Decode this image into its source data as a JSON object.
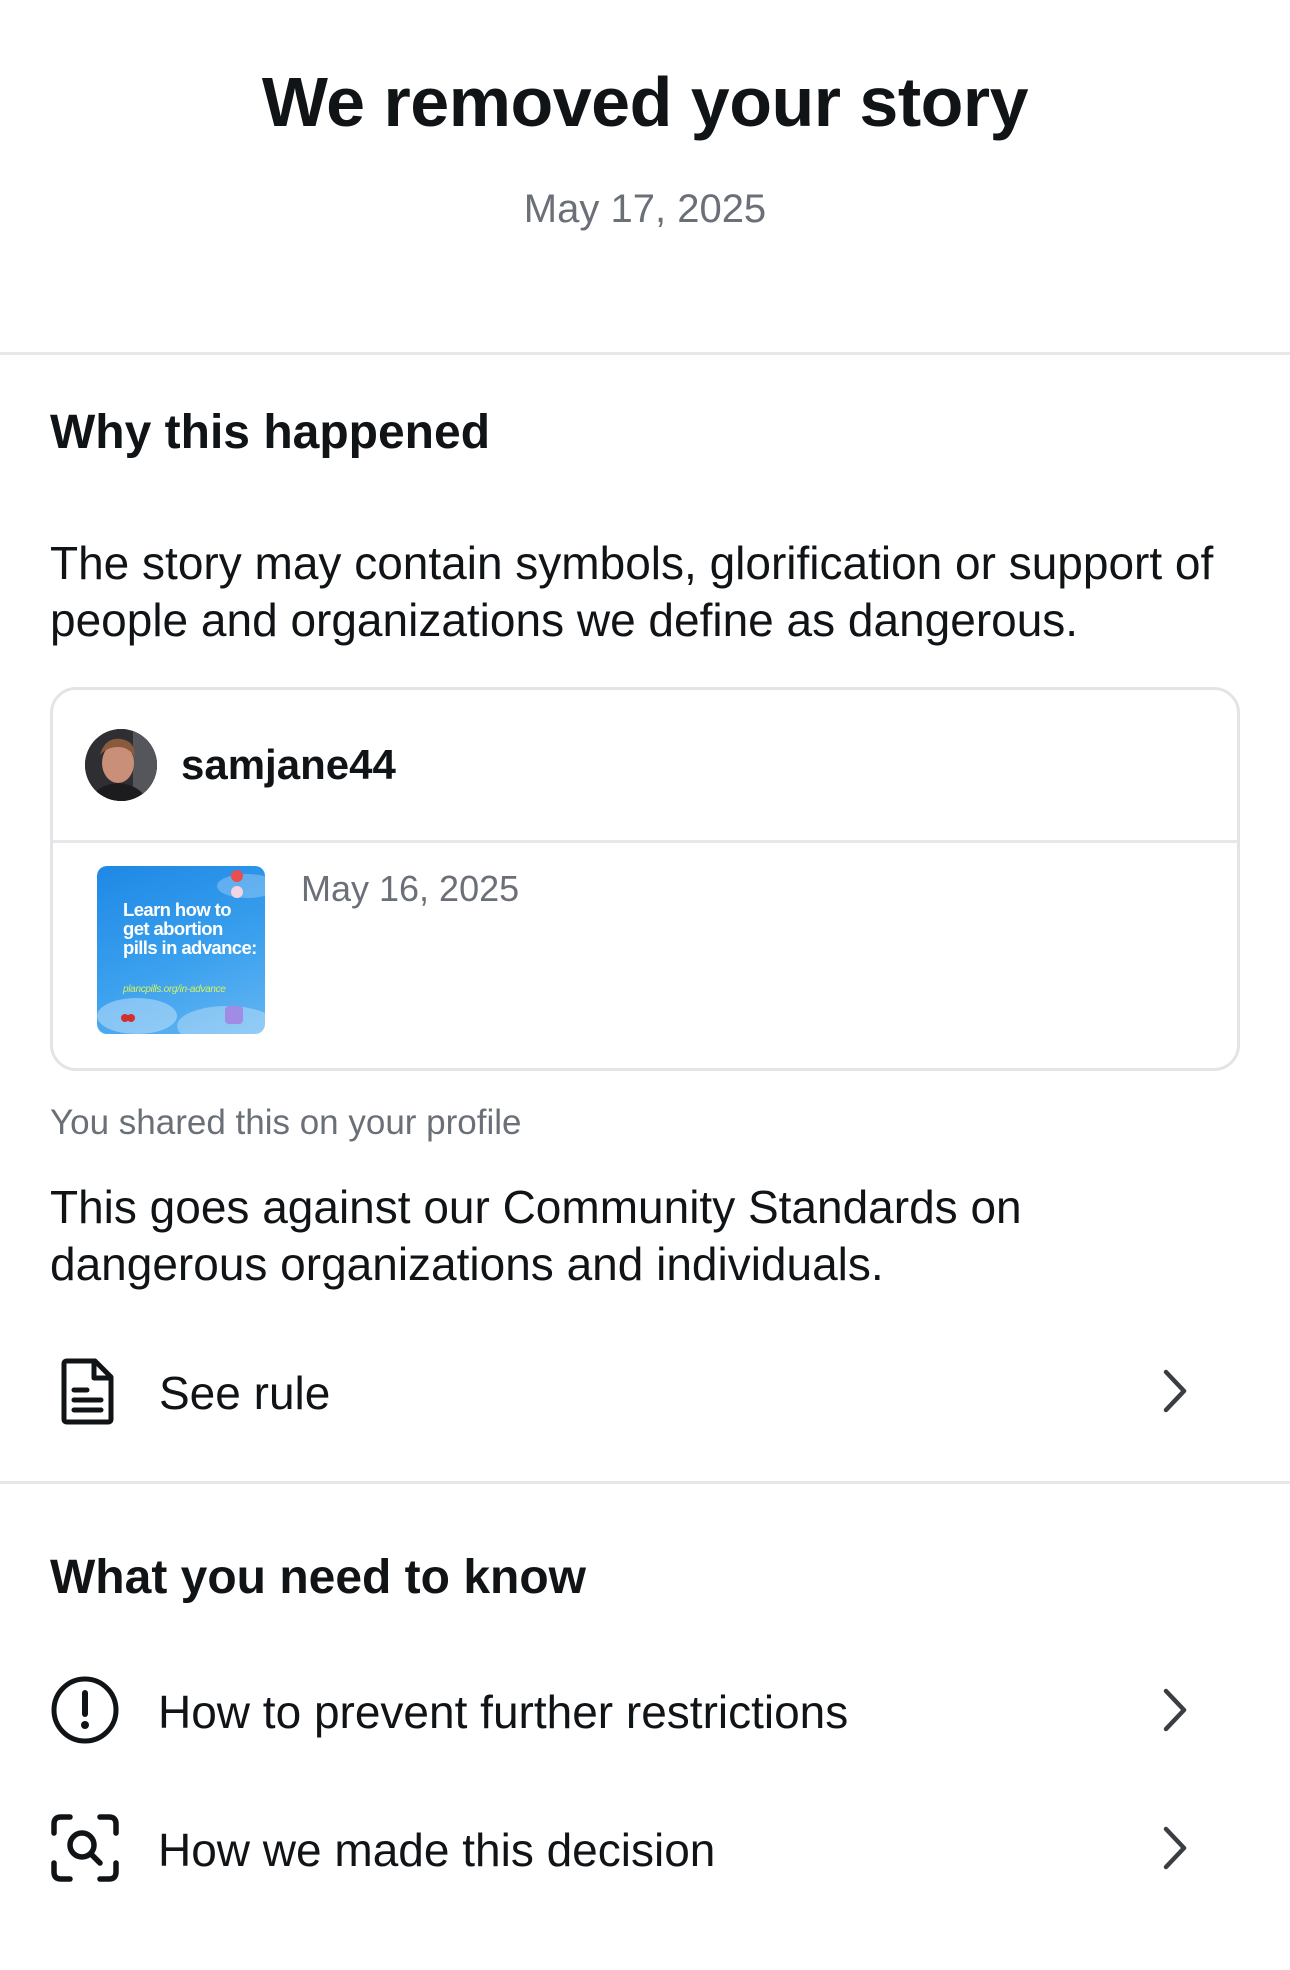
{
  "header": {
    "title": "We removed your story",
    "date": "May 17, 2025"
  },
  "why": {
    "heading": "Why this happened",
    "reason": "The story may contain symbols, glorification or support of people and organizations we define as dangerous.",
    "card": {
      "username": "samjane44",
      "date": "May 16, 2025",
      "thumbnail_text": "Learn how to get abortion pills in advance:",
      "thumbnail_url": "plancpills.org/in-advance"
    },
    "shared_note": "You shared this on your profile",
    "standards_text": "This goes against our Community Standards on dangerous organizations and individuals.",
    "see_rule_label": "See rule"
  },
  "know": {
    "heading": "What you need to know",
    "items": [
      {
        "label": "How to prevent further restrictions",
        "icon": "exclamation-circle-icon"
      },
      {
        "label": "How we made this decision",
        "icon": "scan-search-icon"
      }
    ]
  },
  "colors": {
    "text_primary": "#111417",
    "text_secondary": "#6b7078",
    "divider": "#e6e7e9",
    "thumb_blue": "#1e88e5",
    "thumb_url_green": "#d6f25a"
  }
}
